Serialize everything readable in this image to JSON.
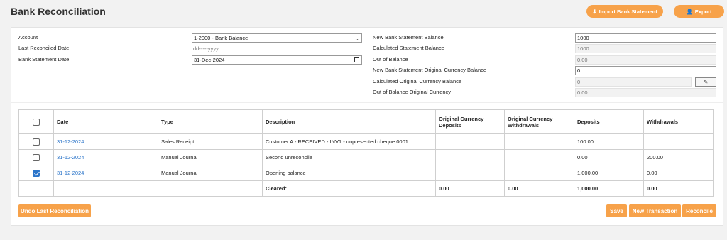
{
  "page": {
    "title": "Bank Reconciliation"
  },
  "header_buttons": {
    "import_label": "Import Bank Statement",
    "export_label": "Export"
  },
  "form": {
    "account_label": "Account",
    "account_value": "1-2000 - Bank Balance",
    "last_reconciled_label": "Last Reconciled Date",
    "last_reconciled_value": "dd-----yyyy",
    "statement_date_label": "Bank Statement Date",
    "statement_date_value": "31-Dec-2024",
    "new_balance_label": "New Bank Statement Balance",
    "new_balance_value": "1000",
    "calc_balance_label": "Calculated Statement Balance",
    "calc_balance_value": "1000",
    "out_of_balance_label": "Out of Balance",
    "out_of_balance_value": "0.00",
    "new_orig_label": "New Bank Statement Original Currency Balance",
    "new_orig_value": "0",
    "calc_orig_label": "Calculated Original Currency Balance",
    "calc_orig_value": "0",
    "out_orig_label": "Out of Balance Original Currency",
    "out_orig_value": "0.00"
  },
  "table": {
    "headers": {
      "date": "Date",
      "type": "Type",
      "description": "Description",
      "orig_deposits": "Original Currency Deposits",
      "orig_withdrawals": "Original Currency Withdrawals",
      "deposits": "Deposits",
      "withdrawals": "Withdrawals"
    },
    "rows": [
      {
        "checked": false,
        "date": "31-12-2024",
        "type": "Sales Receipt",
        "description": "Customer A - RECEIVED - INV1 - unpresented cheque 0001",
        "orig_deposits": "",
        "orig_withdrawals": "",
        "deposits": "100.00",
        "withdrawals": ""
      },
      {
        "checked": false,
        "date": "31-12-2024",
        "type": "Manual Journal",
        "description": "Second unreconcile",
        "orig_deposits": "",
        "orig_withdrawals": "",
        "deposits": "0.00",
        "withdrawals": "200.00"
      },
      {
        "checked": true,
        "date": "31-12-2024",
        "type": "Manual Journal",
        "description": "Opening balance",
        "orig_deposits": "",
        "orig_withdrawals": "",
        "deposits": "1,000.00",
        "withdrawals": "0.00"
      }
    ],
    "footer": {
      "label": "Cleared:",
      "orig_deposits": "0.00",
      "orig_withdrawals": "0.00",
      "deposits": "1,000.00",
      "withdrawals": "0.00"
    }
  },
  "bottom_buttons": {
    "undo_label": "Undo Last Reconciliation",
    "save_label": "Save",
    "new_transaction_label": "New Transaction",
    "reconcile_label": "Reconcile"
  },
  "colors": {
    "accent": "#f7a24a",
    "link": "#2a74c9"
  }
}
